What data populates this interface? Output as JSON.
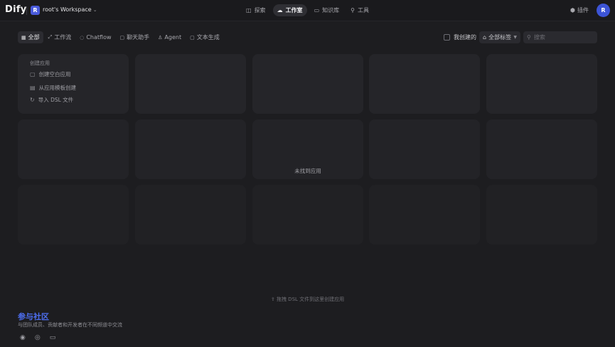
{
  "header": {
    "logo": "Dify",
    "workspace_initial": "R",
    "workspace_name": "root's Workspace",
    "nav": [
      {
        "label": "探索",
        "icon": "explore-icon",
        "glyph": "◫"
      },
      {
        "label": "工作室",
        "icon": "studio-icon",
        "glyph": "☁"
      },
      {
        "label": "知识库",
        "icon": "knowledge-icon",
        "glyph": "▭"
      },
      {
        "label": "工具",
        "icon": "tools-icon",
        "glyph": "⚲"
      }
    ],
    "plugin_label": "插件",
    "user_initial": "R"
  },
  "filters": {
    "tabs": [
      {
        "label": "全部",
        "glyph": "▦"
      },
      {
        "label": "工作流",
        "glyph": "⤢"
      },
      {
        "label": "Chatflow",
        "glyph": "◌"
      },
      {
        "label": "聊天助手",
        "glyph": "▢"
      },
      {
        "label": "Agent",
        "glyph": "♙"
      },
      {
        "label": "文本生成",
        "glyph": "▢"
      }
    ],
    "mine_label": "我创建的",
    "tag_label": "全部标签",
    "search_placeholder": "搜索"
  },
  "create": {
    "title": "创建应用",
    "items": [
      {
        "label": "创建空白应用",
        "glyph": "▢"
      },
      {
        "label": "从应用模板创建",
        "glyph": "▤"
      },
      {
        "label": "导入 DSL 文件",
        "glyph": "↻"
      }
    ]
  },
  "empty_message": "未找到应用",
  "drop_hint": "拖拽 DSL 文件到这里创建应用",
  "community": {
    "title": "参与社区",
    "subtitle": "与团队成员、贡献者和开发者在不同频道中交流",
    "links": [
      {
        "icon": "github-icon",
        "glyph": "◉"
      },
      {
        "icon": "discord-icon",
        "glyph": "◎"
      },
      {
        "icon": "forum-icon",
        "glyph": "▭"
      }
    ]
  },
  "colors": {
    "accent": "#4d6ef0",
    "background": "#1d1d20",
    "card": "#252529"
  }
}
